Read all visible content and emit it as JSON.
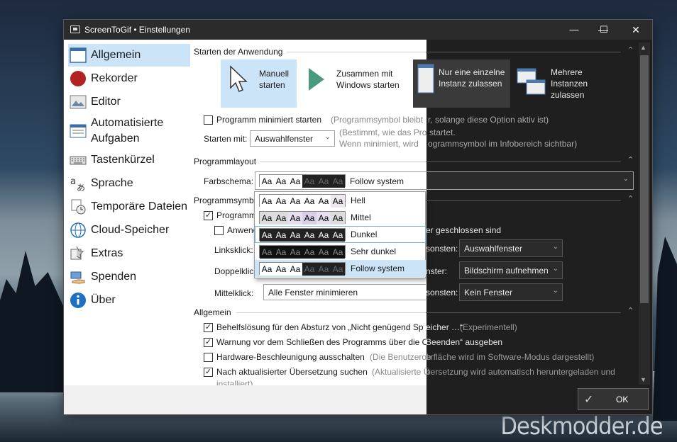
{
  "window": {
    "title": "ScreenToGif • Einstellungen",
    "min": "—",
    "max": "☐",
    "close": "✕"
  },
  "sidebar": {
    "items": [
      {
        "label": "Allgemein",
        "icon": "window-icon"
      },
      {
        "label": "Rekorder",
        "icon": "record-icon"
      },
      {
        "label": "Editor",
        "icon": "editor-icon"
      },
      {
        "label": "Automatisierte\nAufgaben",
        "icon": "tasks-icon"
      },
      {
        "label": "Tastenkürzel",
        "icon": "keyboard-icon"
      },
      {
        "label": "Sprache",
        "icon": "language-icon"
      },
      {
        "label": "Temporäre Dateien",
        "icon": "temp-files-icon"
      },
      {
        "label": "Cloud-Speicher",
        "icon": "globe-icon"
      },
      {
        "label": "Extras",
        "icon": "extras-icon"
      },
      {
        "label": "Spenden",
        "icon": "donate-icon"
      },
      {
        "label": "Über",
        "icon": "info-icon"
      }
    ]
  },
  "startup": {
    "header": "Starten der Anwendung",
    "manual": "Manuell\nstarten",
    "with_windows": "Zusammen mit\nWindows starten",
    "single_instance": "Nur eine einzelne\nInstanz zulassen",
    "multi_instance": "Mehrere\nInstanzen\nzulassen",
    "minimized_label": "Programm minimiert starten",
    "minimized_hint": "(Programmsymbol bleibt",
    "minimized_hint2": "r, solange diese Option aktiv ist)",
    "start_with_label": "Starten mit:",
    "start_with_value": "Auswahlfenster",
    "start_with_hint1": "(Bestimmt, wie das Pro",
    "start_with_hint1b": "startet.",
    "start_with_hint2": "Wenn minimiert, wird",
    "start_with_hint2b": "ogrammsymbol im Infobereich sichtbar)"
  },
  "layout": {
    "header": "Programmlayout",
    "scheme_label": "Farbschema:",
    "scheme_value": "Follow system",
    "sample": "Aa",
    "options": [
      "Hell",
      "Mittel",
      "Dunkel",
      "Sehr dunkel",
      "Follow system"
    ]
  },
  "tray": {
    "header": "Programmsymb",
    "cb1": "Programm",
    "cb2": "Anwend",
    "dark_text": "er geschlossen sind",
    "left_label": "Linksklick:",
    "double_label": "Doppelklic",
    "middle_label": "Mittelklick:",
    "middle_value": "Alle Fenster minimieren",
    "right_lbl1": "sonsten:",
    "right_lbl2": "nster:",
    "right_lbl3": "sonsten:",
    "val1": "Auswahlfenster",
    "val2": "Bildschirm aufnehmen",
    "val3": "Kein Fenster"
  },
  "general": {
    "header": "Allgemein",
    "items": [
      {
        "label": "Behelfslösung für den Absturz von „Nicht genügend Speicher …“",
        "short": "Behelfslösung für den Absturz von „Nicht genügend Sp",
        "dark": "eicher …“",
        "hint": "(Experimentell)",
        "checked": true
      },
      {
        "label": "Warnung vor dem Schließen des Programms über die OBeenden",
        "short": "Warnung vor dem Schließen des Programms über die O",
        "dark": "Beenden“ ausgeben",
        "checked": true
      },
      {
        "label": "Hardware-Beschleunigung ausschalten",
        "hint": "(Die Benutzerob",
        "dark": "erfläche wird im Software-Modus dargestellt)",
        "checked": false
      },
      {
        "label": "Nach aktualisierter Übersetzung suchen",
        "hint": "(Aktualisierte Ü",
        "dark": "bersetzung wird automatisch heruntergeladen und",
        "hint2": "installiert)",
        "checked": true
      }
    ]
  },
  "ok_label": "OK",
  "watermark": "Deskmodder.de"
}
